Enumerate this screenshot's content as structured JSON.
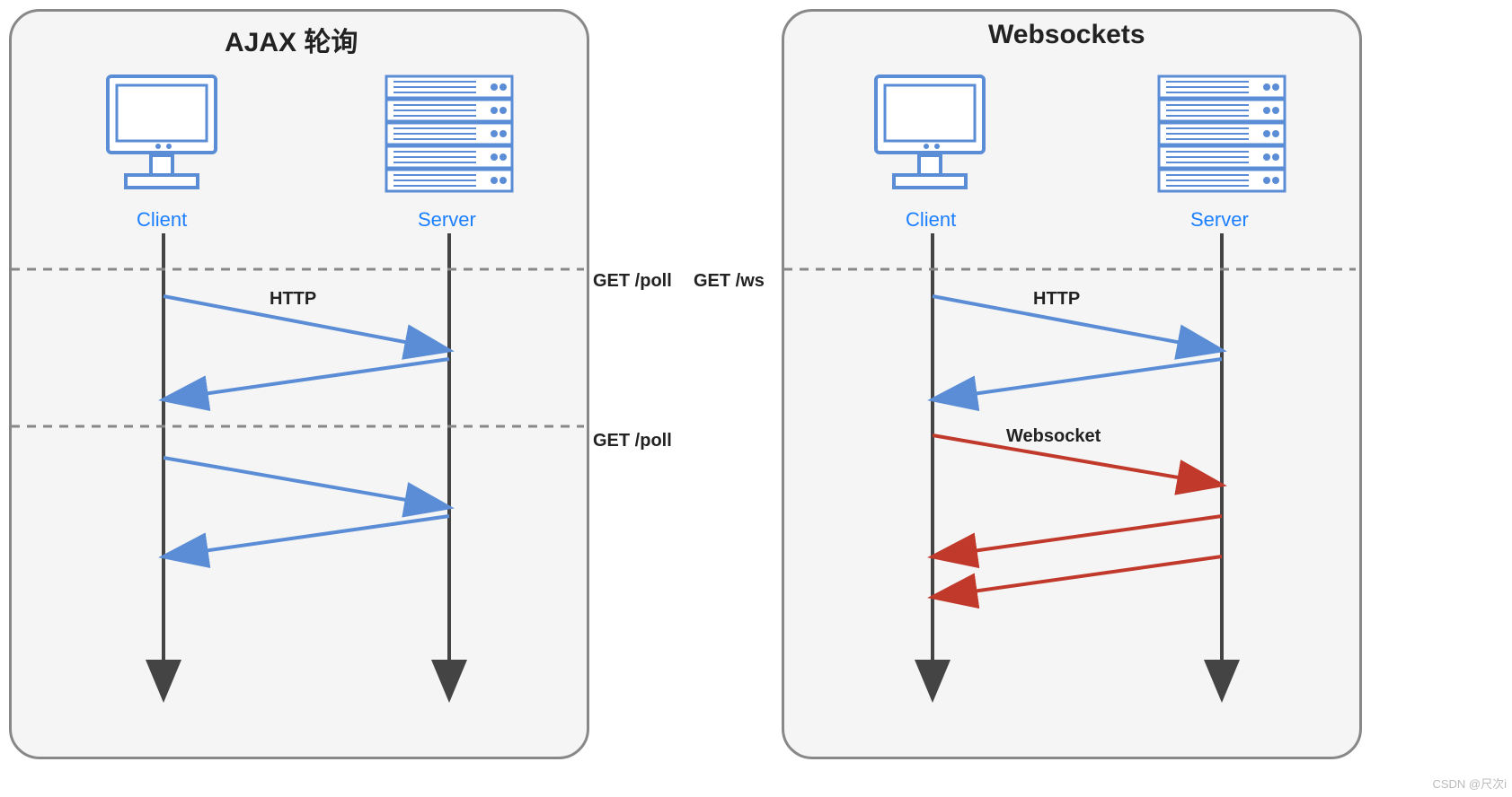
{
  "panels": {
    "left": {
      "title": "AJAX 轮询",
      "client": "Client",
      "server": "Server"
    },
    "right": {
      "title": "Websockets",
      "client": "Client",
      "server": "Server"
    }
  },
  "labels": {
    "http": "HTTP",
    "websocket": "Websocket",
    "get_poll_1": "GET /poll",
    "get_poll_2": "GET /poll",
    "get_ws": "GET /ws"
  },
  "colors": {
    "panel_border": "#888888",
    "panel_fill": "#f5f5f5",
    "icon_blue": "#5a8dd6",
    "text_blue": "#1b7fff",
    "arrow_blue": "#5a8dd6",
    "arrow_red": "#c0392b",
    "lifeline": "#444444",
    "dash": "#888888"
  },
  "watermark": "CSDN @尺次i"
}
